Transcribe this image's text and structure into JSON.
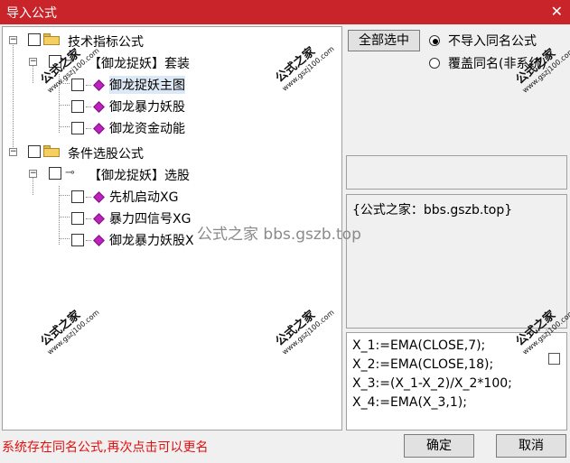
{
  "window": {
    "title": "导入公式",
    "close_glyph": "✕"
  },
  "tree": {
    "groups": [
      {
        "label": "技术指标公式",
        "subgroup": "【御龙捉妖】套装",
        "items": [
          "御龙捉妖主图",
          "御龙暴力妖股",
          "御龙资金动能"
        ]
      },
      {
        "label": "条件选股公式",
        "subgroup": "【御龙捉妖】选股",
        "items": [
          "先机启动XG",
          "暴力四信号XG",
          "御龙暴力妖股X"
        ]
      }
    ],
    "expander_glyph": "−"
  },
  "options": {
    "select_all": "全部选中",
    "no_import_same": "不导入同名公式",
    "overwrite_same": "覆盖同名(非系统)",
    "selected": "no_import_same"
  },
  "description": "{公式之家：bbs.gszb.top}",
  "code_lines": [
    "X_1:=EMA(CLOSE,7);",
    "X_2:=EMA(CLOSE,18);",
    "X_3:=(X_1-X_2)/X_2*100;",
    "X_4:=EMA(X_3,1);"
  ],
  "status_message": "系统存在同名公式,再次点击可以更名",
  "buttons": {
    "ok": "确定",
    "cancel": "取消"
  },
  "watermark": {
    "mark": "公式之家",
    "site": "www.gszj100.com",
    "center": "公式之家 bbs.gszb.top"
  },
  "colors": {
    "titlebar": "#c8242a",
    "status_text": "#e01010",
    "item_icon": "#c020c0"
  }
}
